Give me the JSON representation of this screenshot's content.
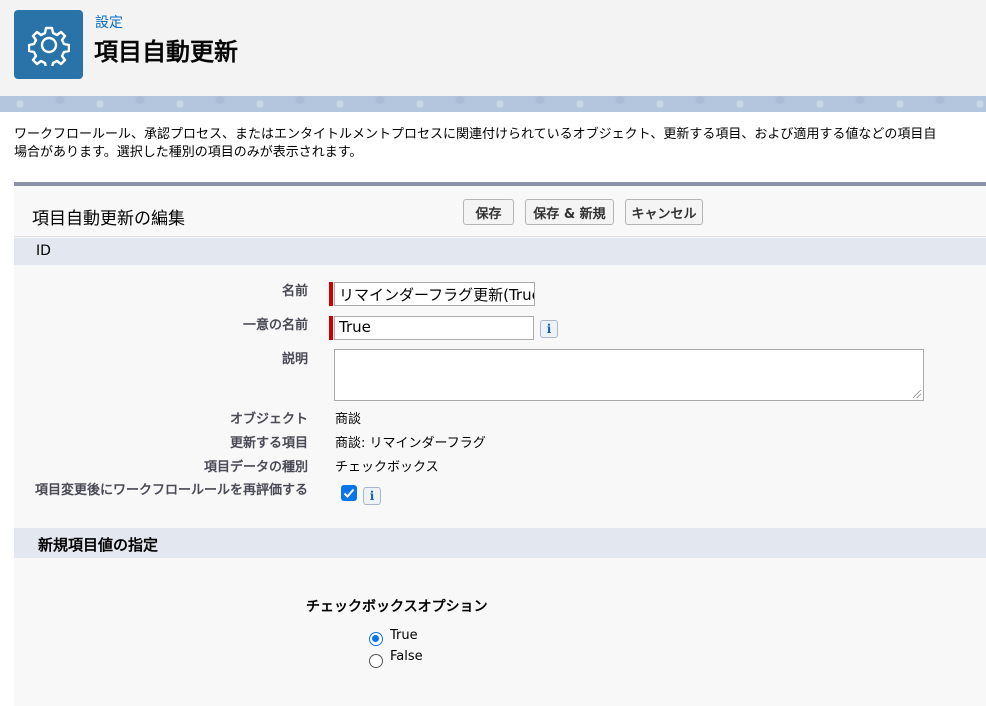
{
  "header": {
    "breadcrumb": "設定",
    "title": "項目自動更新",
    "icon": "gear-icon",
    "brand_color": "#2a73a8"
  },
  "description": {
    "line1": "ワークフロールール、承認プロセス、またはエンタイトルメントプロセスに関連付けられているオブジェクト、更新する項目、および適用する値などの項目自",
    "line2": "場合があります。選択した種別の項目のみが表示されます。"
  },
  "edit": {
    "title": "項目自動更新の編集",
    "buttons": {
      "save": "保存",
      "save_new": "保存 & 新規",
      "cancel": "キャンセル"
    },
    "section_id": "ID",
    "fields": {
      "name_label": "名前",
      "name_value": "リマインダーフラグ更新(True",
      "api_label": "一意の名前",
      "api_value": "True",
      "desc_label": "説明",
      "desc_value": "",
      "object_label": "オブジェクト",
      "object_value": "商談",
      "field_label": "更新する項目",
      "field_value": "商談: リマインダーフラグ",
      "type_label": "項目データの種別",
      "type_value": "チェックボックス",
      "reeval_label": "項目変更後にワークフロールールを再評価する",
      "reeval_checked": true
    },
    "section_new": "新規項目値の指定",
    "options": {
      "title": "チェックボックスオプション",
      "true_label": "True",
      "false_label": "False",
      "selected": "True"
    }
  },
  "colors": {
    "accent": "#0a74e8",
    "required": "#cc0000",
    "section_bar": "#e3e7ef"
  }
}
